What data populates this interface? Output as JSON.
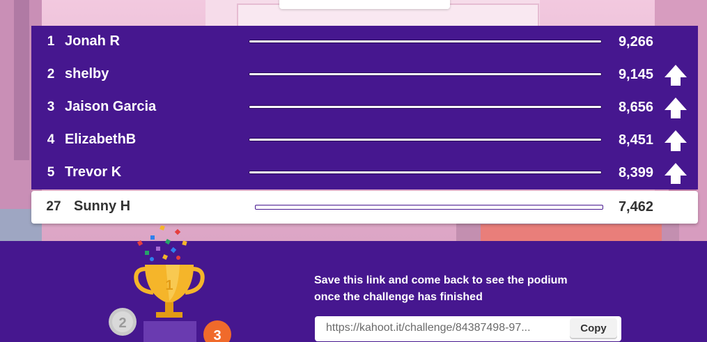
{
  "leaderboard": {
    "rows": [
      {
        "rank": "1",
        "name": "Jonah R",
        "score": "9,266",
        "rank_change": "none"
      },
      {
        "rank": "2",
        "name": "shelby",
        "score": "9,145",
        "rank_change": "up"
      },
      {
        "rank": "3",
        "name": "Jaison Garcia",
        "score": "8,656",
        "rank_change": "up"
      },
      {
        "rank": "4",
        "name": "ElizabethB",
        "score": "8,451",
        "rank_change": "up"
      },
      {
        "rank": "5",
        "name": "Trevor K",
        "score": "8,399",
        "rank_change": "up"
      }
    ],
    "current_player": {
      "rank": "27",
      "name": "Sunny H",
      "score": "7,462"
    }
  },
  "footer": {
    "message_line1": "Save this link and come back to see the podium",
    "message_line2": "once the challenge has finished",
    "link_value": "https://kahoot.it/challenge/84387498-97...",
    "copy_label": "Copy",
    "podium": {
      "first": "1",
      "second": "2",
      "third": "3"
    }
  },
  "colors": {
    "brand_purple": "#46178f",
    "trophy_gold": "#f5b52a",
    "background_pink": "#e8b9d4"
  }
}
